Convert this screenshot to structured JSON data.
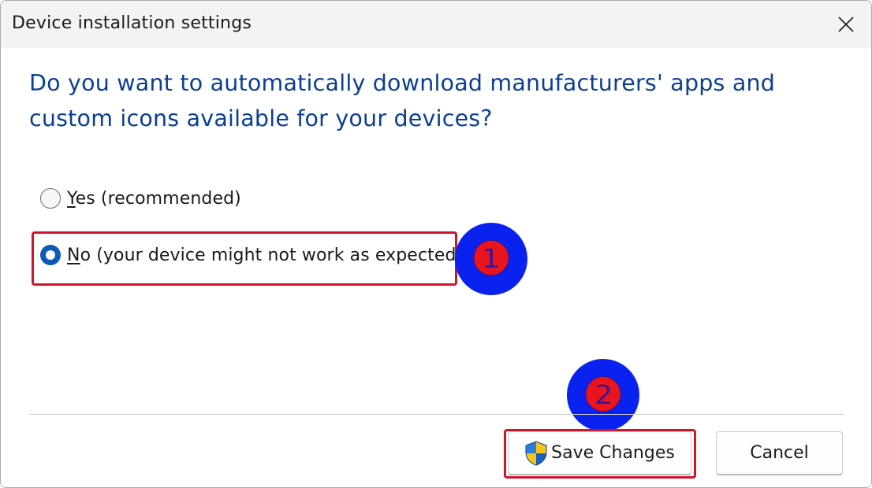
{
  "window": {
    "title": "Device installation settings",
    "close_icon": "close-icon"
  },
  "dialog": {
    "question": "Do you want to automatically download manufacturers' apps and custom icons available for your devices?",
    "options": [
      {
        "accel": "Y",
        "rest": "es (recommended)",
        "selected": false
      },
      {
        "accel": "N",
        "rest": "o (your device might not work as expected)",
        "selected": true
      }
    ]
  },
  "buttons": {
    "save_label": "Save Changes",
    "save_icon": "uac-shield-icon",
    "cancel_label": "Cancel"
  },
  "annotations": {
    "step1": "❶",
    "step2": "❷"
  },
  "colors": {
    "question_text": "#0b3e94",
    "radio_selected": "#0b5cb8",
    "highlight_border": "#d0142c",
    "badge_fill": "#0a22f0",
    "badge_number": "#e8141e"
  }
}
